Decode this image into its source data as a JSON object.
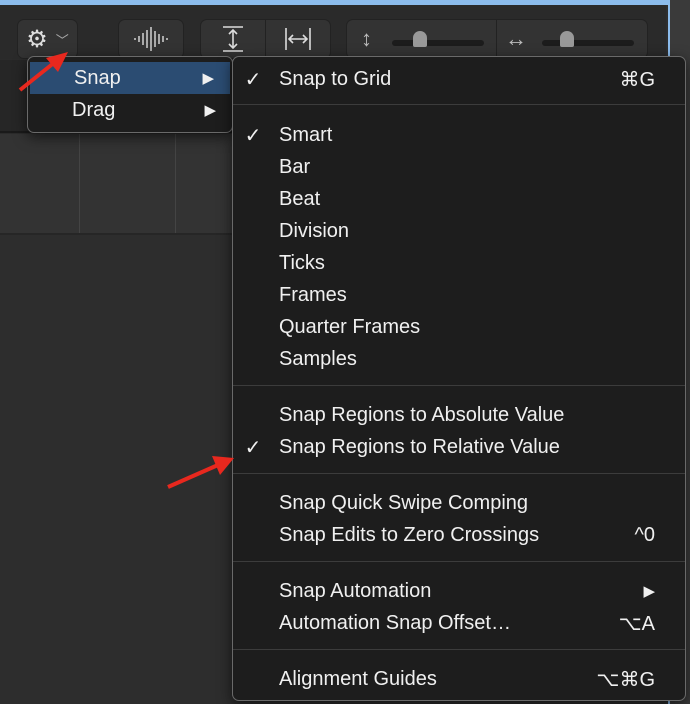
{
  "toolbar": {
    "buttons": [
      "gear-menu",
      "waveform-zoom",
      "vertical-fit",
      "horizontal-fit",
      "vertical-zoom-slider",
      "horizontal-zoom-slider"
    ],
    "vertical_zoom_level": 0.3,
    "horizontal_zoom_level": 0.3
  },
  "gear_menu": {
    "items": [
      {
        "label": "Snap",
        "highlighted": true
      },
      {
        "label": "Drag"
      }
    ]
  },
  "snap_menu": {
    "groups": [
      [
        {
          "label": "Snap to Grid",
          "checked": true,
          "shortcut": "⌘G"
        }
      ],
      [
        {
          "label": "Smart",
          "checked": true
        },
        {
          "label": "Bar"
        },
        {
          "label": "Beat"
        },
        {
          "label": "Division"
        },
        {
          "label": "Ticks"
        },
        {
          "label": "Frames"
        },
        {
          "label": "Quarter Frames"
        },
        {
          "label": "Samples"
        }
      ],
      [
        {
          "label": "Snap Regions to Absolute Value"
        },
        {
          "label": "Snap Regions to Relative Value",
          "checked": true
        }
      ],
      [
        {
          "label": "Snap Quick Swipe Comping"
        },
        {
          "label": "Snap Edits to Zero Crossings",
          "shortcut": "^0"
        }
      ],
      [
        {
          "label": "Snap Automation",
          "submenu": true
        },
        {
          "label": "Automation Snap Offset…",
          "shortcut": "⌥A"
        }
      ],
      [
        {
          "label": "Alignment Guides",
          "shortcut": "⌥⌘G"
        }
      ]
    ],
    "check_glyph": "✓",
    "submenu_glyph": "▶"
  },
  "colors": {
    "highlight": "#2b4c72",
    "annotation_arrow": "#e8281e",
    "window_accent": "#8cbcec"
  }
}
